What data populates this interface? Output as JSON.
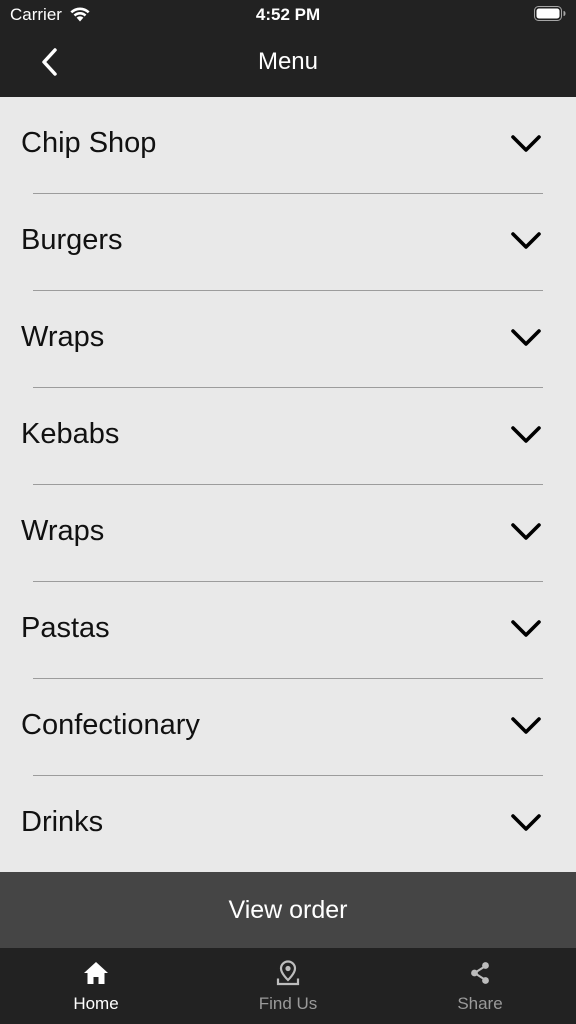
{
  "status": {
    "carrier": "Carrier",
    "time": "4:52 PM"
  },
  "header": {
    "title": "Menu"
  },
  "menu": {
    "items": [
      {
        "label": "Chip Shop"
      },
      {
        "label": "Burgers"
      },
      {
        "label": "Wraps"
      },
      {
        "label": "Kebabs"
      },
      {
        "label": "Wraps"
      },
      {
        "label": "Pastas"
      },
      {
        "label": "Confectionary"
      },
      {
        "label": "Drinks"
      }
    ]
  },
  "footer": {
    "view_order_label": "View order"
  },
  "tabs": [
    {
      "label": "Home",
      "icon": "home-icon",
      "active": true
    },
    {
      "label": "Find Us",
      "icon": "map-pin-icon",
      "active": false
    },
    {
      "label": "Share",
      "icon": "share-icon",
      "active": false
    }
  ],
  "colors": {
    "bar": "#222222",
    "background": "#e9e9e9",
    "button": "#454545"
  }
}
